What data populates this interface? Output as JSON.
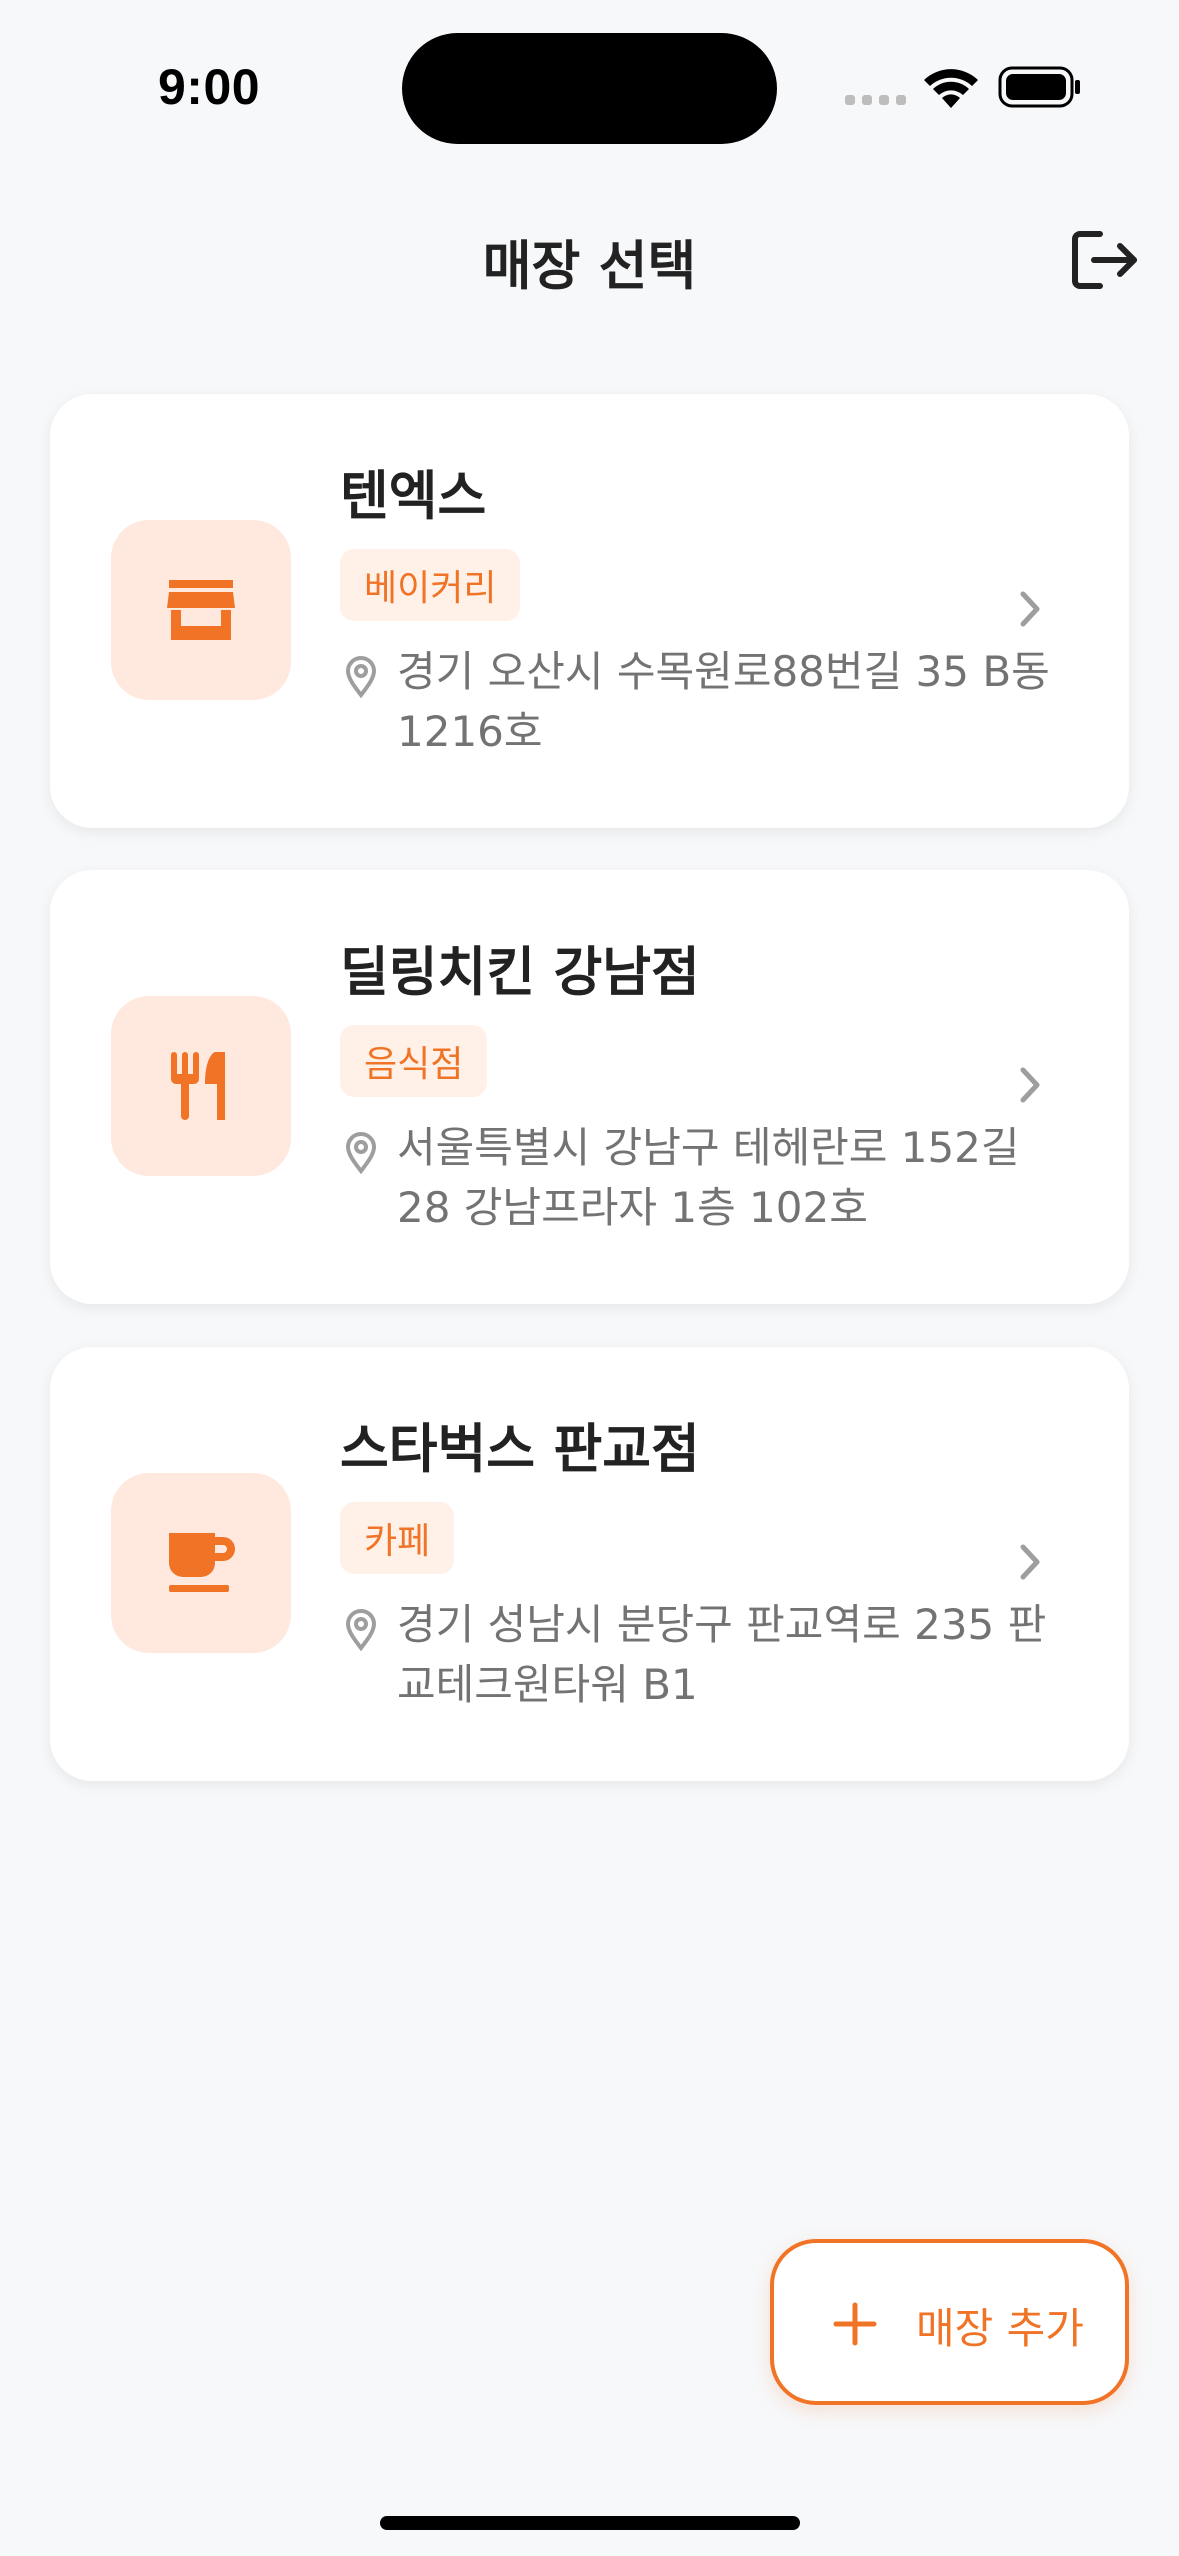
{
  "status_bar": {
    "time": "9:00"
  },
  "header": {
    "title": "매장 선택",
    "logout_icon": "logout-icon"
  },
  "stores": [
    {
      "name": "텐엑스",
      "category": "베이커리",
      "icon": "store-icon",
      "address": "경기 오산시 수목원로88번길 35 B동 1216호"
    },
    {
      "name": "딜링치킨 강남점",
      "category": "음식점",
      "icon": "restaurant-icon",
      "address": "서울특별시 강남구 테헤란로 152길 28 강남프라자 1층 102호"
    },
    {
      "name": "스타벅스 판교점",
      "category": "카페",
      "icon": "cafe-icon",
      "address": "경기 성남시 분당구 판교역로 235 판교테크원타워 B1"
    }
  ],
  "fab": {
    "label": "매장 추가",
    "icon": "plus-icon"
  },
  "colors": {
    "accent": "#F07326",
    "icon_bg": "#FFE9DE",
    "badge_bg": "#FFF1E8",
    "background": "#F7F8FA",
    "address_text": "#737373"
  }
}
